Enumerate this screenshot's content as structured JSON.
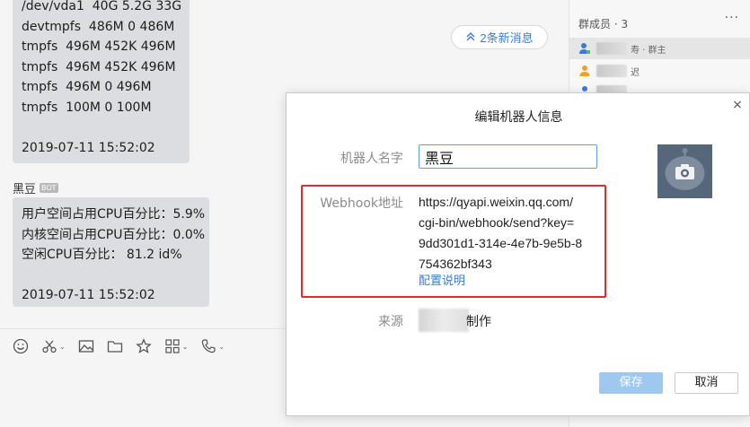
{
  "chat": {
    "message1_lines": [
      "/dev/vda1  40G 5.2G 33G",
      "devtmpfs  486M 0 486M",
      "tmpfs  496M 452K 496M",
      "tmpfs  496M 452K 496M",
      "tmpfs  496M 0 496M",
      "tmpfs  100M 0 100M",
      "",
      "2019-07-11 15:52:02"
    ],
    "sender_name": "黑豆",
    "sender_badge": "BOT",
    "message2_lines": [
      "用户空间占用CPU百分比：5.9%",
      "内核空间占用CPU百分比：0.0%",
      "空闲CPU百分比： 81.2 id%",
      "",
      "2019-07-11 15:52:02"
    ],
    "new_messages_label": "2条新消息",
    "toolbar_icons": [
      "emoji-icon",
      "scissors-icon",
      "image-icon",
      "folder-icon",
      "star-icon",
      "apps-icon",
      "phone-icon"
    ]
  },
  "members": {
    "header": "群成员 · 3",
    "more": "···",
    "owner_tag": "寿 · 群主",
    "member2_tag": "迟"
  },
  "dialog": {
    "title": "编辑机器人信息",
    "close": "×",
    "name_label": "机器人名字",
    "name_value": "黑豆",
    "webhook_label": "Webhook地址",
    "webhook_url_lines": [
      "https://qyapi.weixin.qq.com/",
      "cgi-bin/webhook/send?key=",
      "9dd301d1-314e-4e7b-9e5b-8",
      "754362bf343"
    ],
    "config_link": "配置说明",
    "source_label": "来源",
    "source_value": "制作",
    "save_label": "保存",
    "cancel_label": "取消"
  },
  "colors": {
    "accent": "#3a7bd5",
    "highlight_border": "#e02b2b",
    "save_disabled": "#9ec8f0",
    "bubble": "#dcdde1"
  }
}
